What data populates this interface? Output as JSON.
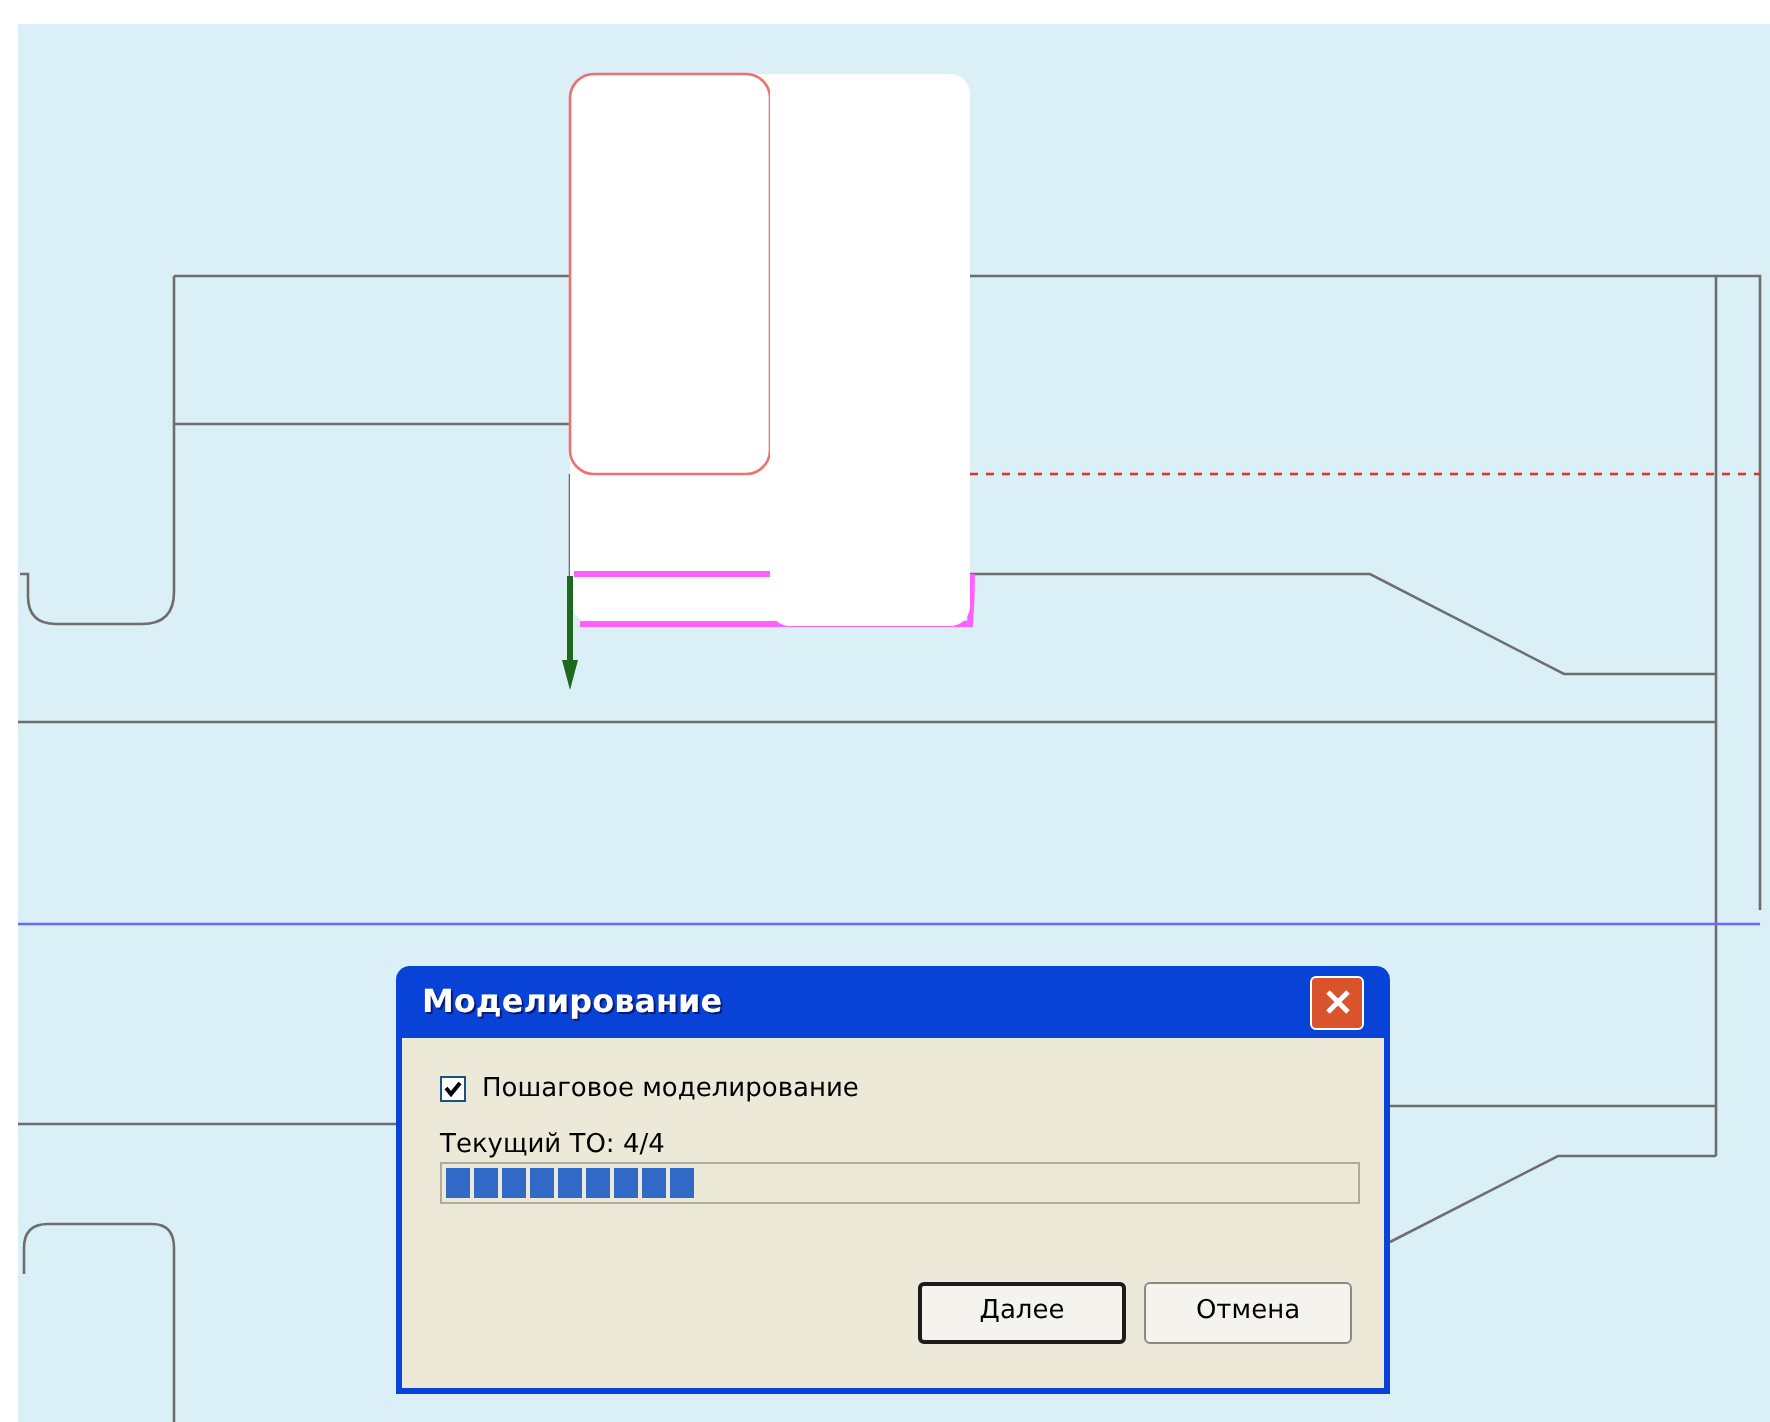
{
  "dialog": {
    "title": "Моделирование",
    "checkbox": {
      "label": "Пошаговое моделирование",
      "checked": true
    },
    "progress": {
      "label": "Текущий ТО: 4/4",
      "level": 0.27
    },
    "buttons": [
      {
        "label": "Далее",
        "default": true
      },
      {
        "label": "Отмена",
        "default": false
      }
    ]
  }
}
